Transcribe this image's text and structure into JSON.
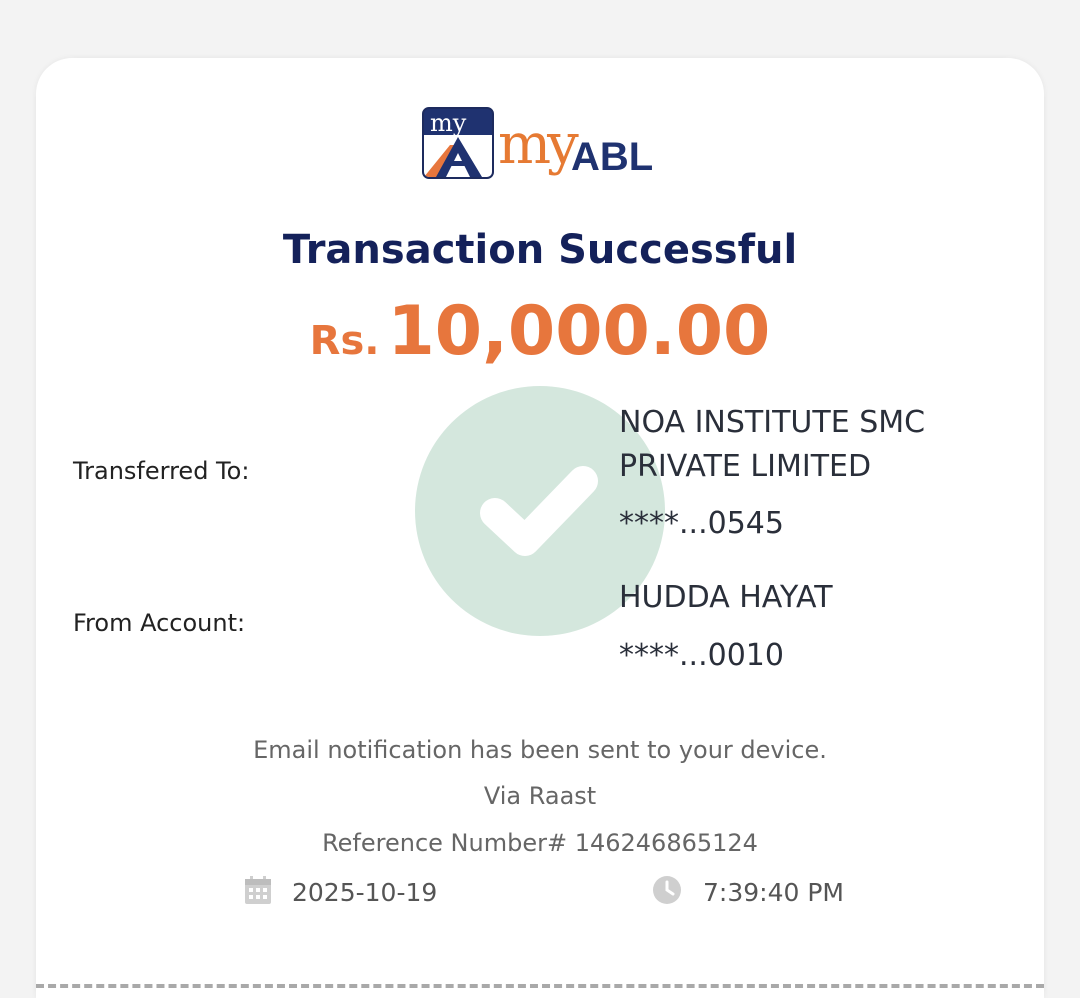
{
  "brand": {
    "logo_text_my": "my",
    "logo_text_abl": "ABL",
    "badge_text": "my",
    "colors": {
      "navy": "#14215a",
      "orange": "#e7763d",
      "check_circle": "#d4e7dd"
    }
  },
  "receipt": {
    "title": "Transaction Successful",
    "currency": "Rs.",
    "amount": "10,000.00",
    "transferred_to_label": "Transferred To:",
    "recipient_name": "NOA INSTITUTE SMC PRIVATE LIMITED",
    "recipient_account": "****...0545",
    "from_account_label": "From Account:",
    "sender_name": "HUDDA HAYAT",
    "sender_account": "****...0010",
    "notification": "Email notification has been sent to your device.",
    "via": "Via Raast",
    "reference": "Reference Number# 146246865124",
    "date": "2025-10-19",
    "time": "7:39:40 PM"
  },
  "icons": {
    "success": "check-circle-icon",
    "date": "calendar-icon",
    "time": "clock-icon"
  }
}
